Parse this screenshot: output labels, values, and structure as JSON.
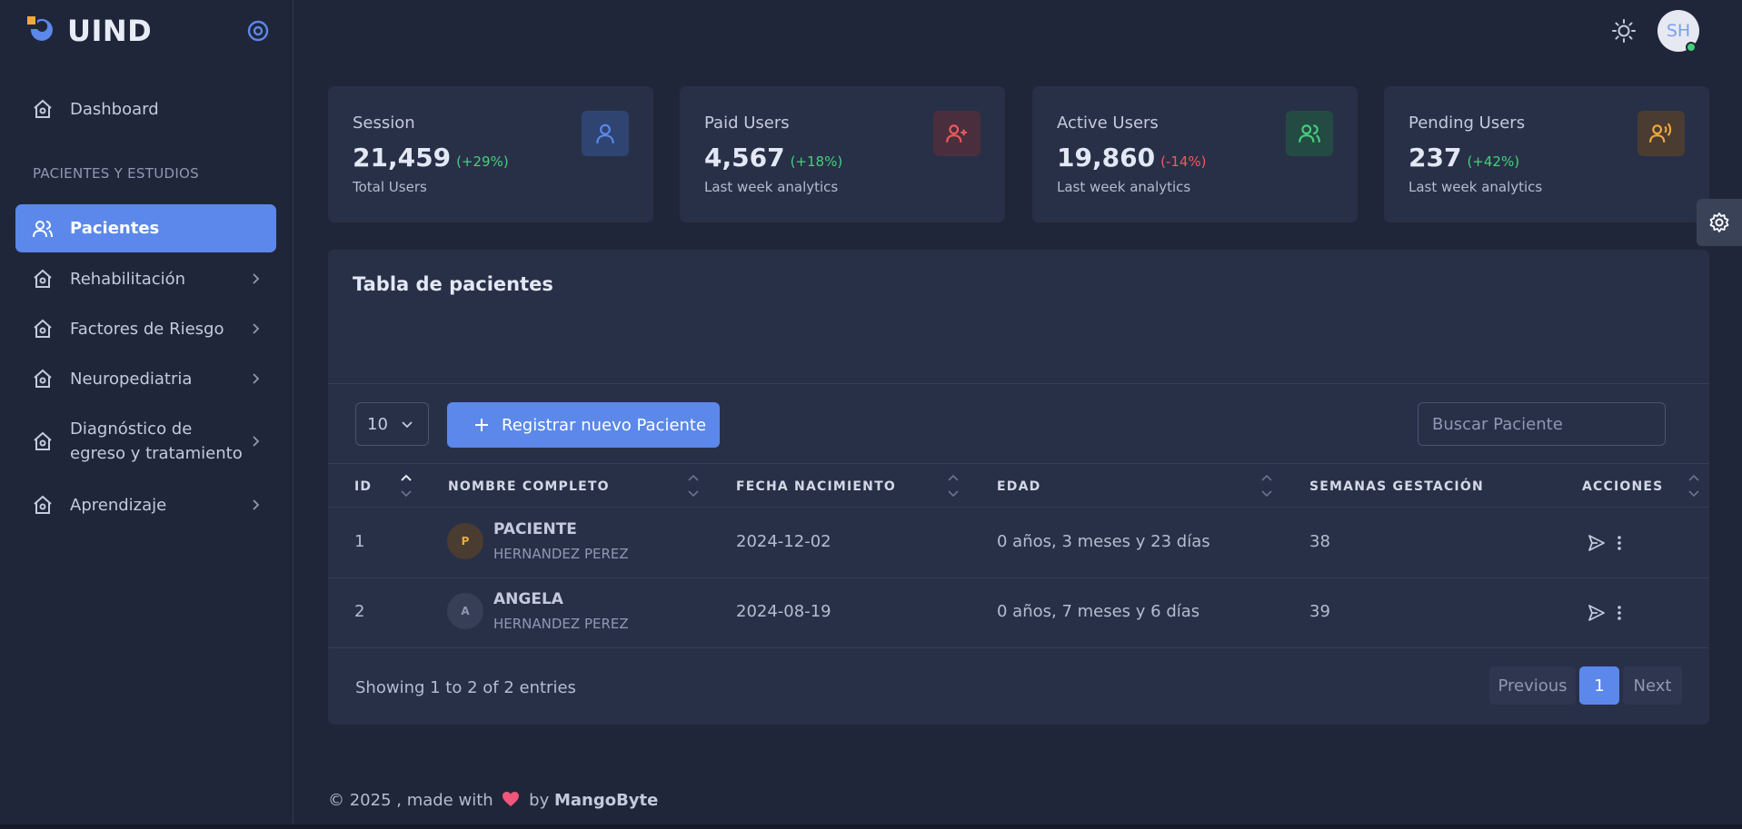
{
  "brand": {
    "name": "UIND"
  },
  "sidebar": {
    "dashboard": "Dashboard",
    "section_title": "PACIENTES Y ESTUDIOS",
    "items": [
      {
        "label": "Pacientes"
      },
      {
        "label": "Rehabilitación"
      },
      {
        "label": "Factores de Riesgo"
      },
      {
        "label": "Neuropediatria"
      },
      {
        "label_line1": "Diagnóstico de",
        "label_line2": "egreso y tratamiento"
      },
      {
        "label": "Aprendizaje"
      }
    ]
  },
  "topbar": {
    "user_initials": "SH"
  },
  "cards": [
    {
      "title": "Session",
      "value": "21,459",
      "change": "(+29%)",
      "sub": "Total Users",
      "change_color": "#44d07a"
    },
    {
      "title": "Paid Users",
      "value": "4,567",
      "change": "(+18%)",
      "sub": "Last week analytics",
      "change_color": "#44d07a"
    },
    {
      "title": "Active Users",
      "value": "19,860",
      "change": "(-14%)",
      "sub": "Last week analytics",
      "change_color": "#ef5a5a"
    },
    {
      "title": "Pending Users",
      "value": "237",
      "change": "(+42%)",
      "sub": "Last week analytics",
      "change_color": "#44d07a"
    }
  ],
  "table_panel": {
    "title": "Tabla de pacientes",
    "page_size": "10",
    "add_button": "Registrar nuevo Paciente",
    "search_placeholder": "Buscar Paciente",
    "columns": [
      "ID",
      "NOMBRE COMPLETO",
      "FECHA NACIMIENTO",
      "EDAD",
      "SEMANAS GESTACIÓN",
      "ACCIONES"
    ],
    "rows": [
      {
        "id": "1",
        "initial": "P",
        "name": "PACIENTE",
        "surname": "HERNANDEZ PEREZ",
        "birth": "2024-12-02",
        "age": "0 años, 3 meses y 23 días",
        "weeks": "38"
      },
      {
        "id": "2",
        "initial": "A",
        "name": "ANGELA",
        "surname": "HERNANDEZ PEREZ",
        "birth": "2024-08-19",
        "age": "0 años, 7 meses y 6 días",
        "weeks": "39"
      }
    ],
    "info": "Showing 1 to 2 of 2 entries",
    "pagination": {
      "prev": "Previous",
      "current": "1",
      "next": "Next"
    }
  },
  "footer": {
    "prefix": "© 2025 , made with",
    "by": "by",
    "company": "MangoByte"
  }
}
